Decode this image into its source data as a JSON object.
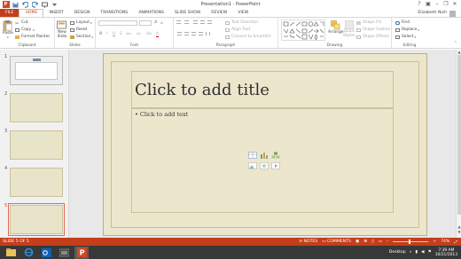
{
  "window": {
    "title": "Presentation1 - PowerPoint",
    "controls": {
      "help": "?",
      "ribbon_options": "▣",
      "minimize": "–",
      "restore": "❐",
      "close": "✕"
    }
  },
  "tabs": [
    {
      "label": "FILE"
    },
    {
      "label": "HOME"
    },
    {
      "label": "INSERT"
    },
    {
      "label": "DESIGN"
    },
    {
      "label": "TRANSITIONS"
    },
    {
      "label": "ANIMATIONS"
    },
    {
      "label": "SLIDE SHOW"
    },
    {
      "label": "REVIEW"
    },
    {
      "label": "VIEW"
    }
  ],
  "user": {
    "name": "Elizabeth Nish"
  },
  "ribbon": {
    "clipboard": {
      "label": "Clipboard",
      "paste": "Paste",
      "cut": "Cut",
      "copy": "Copy",
      "format_painter": "Format Painter"
    },
    "slides": {
      "label": "Slides",
      "new_slide": "New",
      "new_slide_2": "Slide",
      "layout": "Layout",
      "reset": "Reset",
      "section": "Section"
    },
    "font": {
      "label": "Font",
      "bold": "B",
      "italic": "I",
      "underline": "U",
      "strike": "S",
      "shadow": "abc",
      "spacing": "AV",
      "case": "Aa",
      "color": "A",
      "grow": "A",
      "shrink": "A"
    },
    "paragraph": {
      "label": "Paragraph",
      "text_direction": "Text Direction",
      "align_text": "Align Text",
      "convert_smartart": "Convert to SmartArt"
    },
    "drawing": {
      "label": "Drawing",
      "arrange": "Arrange",
      "quick_styles": "Quick",
      "quick_styles_2": "Styles",
      "shape_fill": "Shape Fill",
      "shape_outline": "Shape Outline",
      "shape_effects": "Shape Effects"
    },
    "editing": {
      "label": "Editing",
      "find": "Find",
      "replace": "Replace",
      "select": "Select"
    }
  },
  "slides": [
    {
      "number": "1"
    },
    {
      "number": "2"
    },
    {
      "number": "3"
    },
    {
      "number": "4"
    },
    {
      "number": "5"
    }
  ],
  "slide": {
    "title_placeholder": "Click to add title",
    "content_placeholder": "Click to add text"
  },
  "status": {
    "slide_info": "SLIDE 5 OF 5",
    "notes": "NOTES",
    "comments": "COMMENTS",
    "zoom": "74%"
  },
  "taskbar": {
    "desktop": "Desktop",
    "time": "7:39 AM",
    "date": "10/21/2013"
  },
  "colors": {
    "accent": "#c43e1c",
    "slide_bg": "#ece7cc",
    "taskbar": "#383838"
  }
}
